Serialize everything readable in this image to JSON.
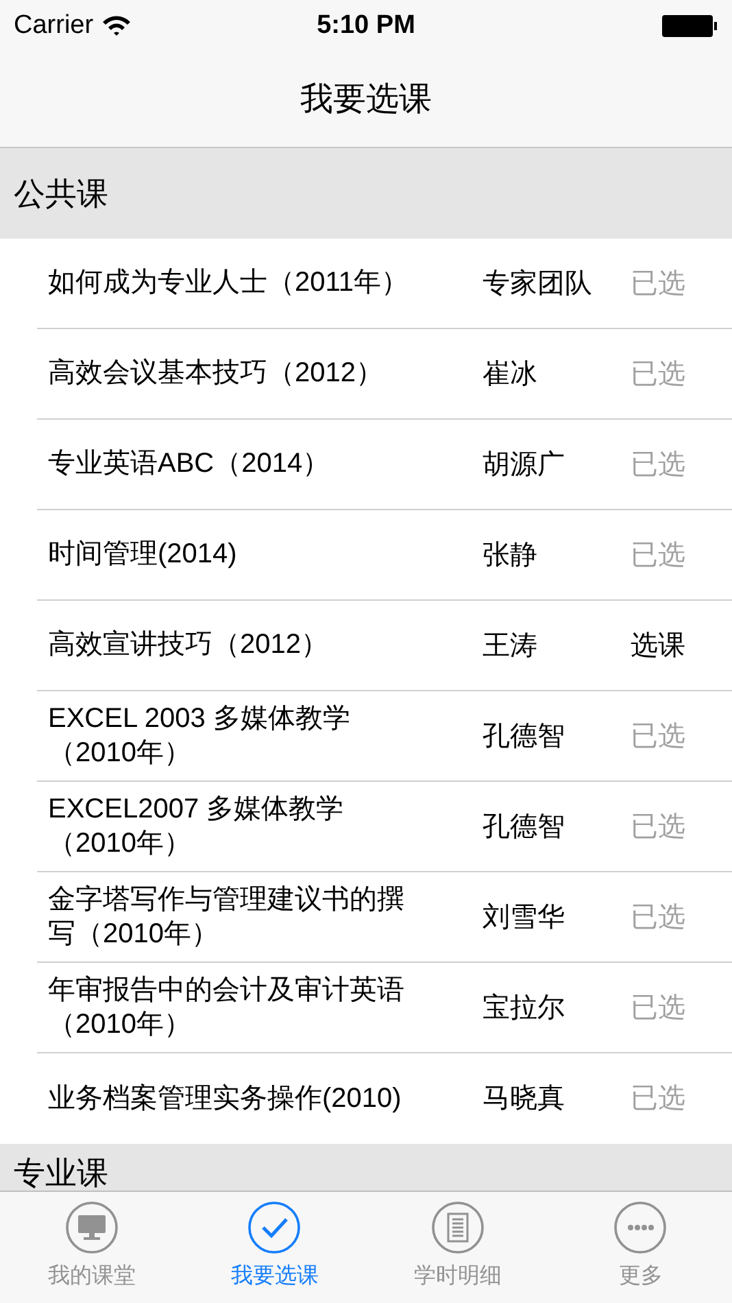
{
  "status_bar": {
    "carrier": "Carrier",
    "time": "5:10 PM"
  },
  "nav": {
    "title": "我要选课"
  },
  "sections": [
    {
      "title": "公共课",
      "rows": [
        {
          "course": "如何成为专业人士（2011年）",
          "teacher": "专家团队",
          "action": "已选",
          "chosen": true
        },
        {
          "course": "高效会议基本技巧（2012）",
          "teacher": "崔冰",
          "action": "已选",
          "chosen": true
        },
        {
          "course": "专业英语ABC（2014）",
          "teacher": "胡源广",
          "action": "已选",
          "chosen": true
        },
        {
          "course": "时间管理(2014)",
          "teacher": "张静",
          "action": "已选",
          "chosen": true
        },
        {
          "course": "高效宣讲技巧（2012）",
          "teacher": "王涛",
          "action": "选课",
          "chosen": false
        },
        {
          "course": "EXCEL 2003 多媒体教学（2010年）",
          "teacher": "孔德智",
          "action": "已选",
          "chosen": true
        },
        {
          "course": "EXCEL2007 多媒体教学（2010年）",
          "teacher": "孔德智",
          "action": "已选",
          "chosen": true
        },
        {
          "course": "金字塔写作与管理建议书的撰写（2010年）",
          "teacher": "刘雪华",
          "action": "已选",
          "chosen": true
        },
        {
          "course": "年审报告中的会计及审计英语（2010年）",
          "teacher": "宝拉尔",
          "action": "已选",
          "chosen": true
        },
        {
          "course": "业务档案管理实务操作(2010)",
          "teacher": "马晓真",
          "action": "已选",
          "chosen": true
        }
      ]
    },
    {
      "title": "专业课"
    }
  ],
  "tabs": [
    {
      "label": "我的课堂",
      "kind": "monitor",
      "selected": false
    },
    {
      "label": "我要选课",
      "kind": "check",
      "selected": true
    },
    {
      "label": "学时明细",
      "kind": "document",
      "selected": false
    },
    {
      "label": "更多",
      "kind": "more",
      "selected": false
    }
  ]
}
